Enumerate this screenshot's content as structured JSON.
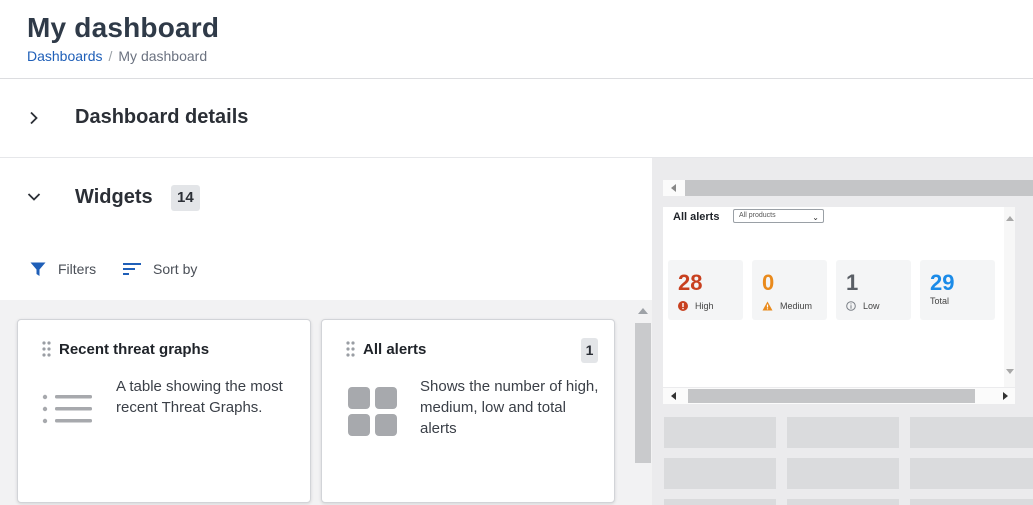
{
  "header": {
    "title": "My dashboard",
    "breadcrumb": {
      "link": "Dashboards",
      "separator": "/",
      "current": "My dashboard"
    }
  },
  "details": {
    "title": "Dashboard details"
  },
  "widgets": {
    "title": "Widgets",
    "count": "14",
    "filters_label": "Filters",
    "sort_label": "Sort by",
    "cards": [
      {
        "title": "Recent threat graphs",
        "description": "A table showing the most recent Threat Graphs.",
        "icon": "list-icon"
      },
      {
        "title": "All alerts",
        "description": "Shows the number of high, medium, low and total alerts",
        "icon": "grid-icon",
        "badge": "1"
      }
    ]
  },
  "preview": {
    "title": "All alerts",
    "select_value": "All products",
    "stats": [
      {
        "value": "28",
        "label": "High",
        "color": "#c8401f",
        "icon": "error-circle-icon"
      },
      {
        "value": "0",
        "label": "Medium",
        "color": "#e98a1c",
        "icon": "warning-triangle-icon"
      },
      {
        "value": "1",
        "label": "Low",
        "color": "#5a5f66",
        "icon": "info-circle-icon"
      },
      {
        "value": "29",
        "label": "Total",
        "color": "#1b8be8",
        "icon": ""
      }
    ]
  },
  "colors": {
    "link": "#1f5fb8",
    "filter_icon": "#1f5fb8",
    "high": "#c8401f",
    "medium": "#e98a1c",
    "total": "#1b8be8"
  }
}
